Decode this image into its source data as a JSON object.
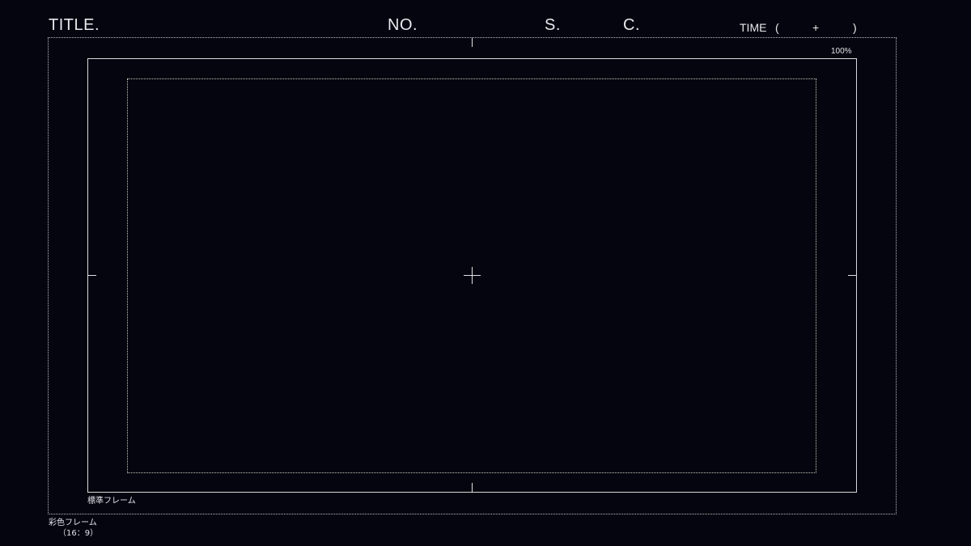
{
  "header": {
    "title_label": "TITLE.",
    "no_label": "NO.",
    "s_label": "S.",
    "c_label": "C.",
    "time_label": "TIME",
    "time_open": "(",
    "time_plus": "+",
    "time_close": ")"
  },
  "frames": {
    "percent_label": "100%",
    "standard_frame_label": "標準フレーム",
    "color_frame_label": "彩色フレーム",
    "aspect_label": "（16：9）"
  },
  "colors": {
    "background": "#05050f",
    "line": "#e0e0e6"
  }
}
